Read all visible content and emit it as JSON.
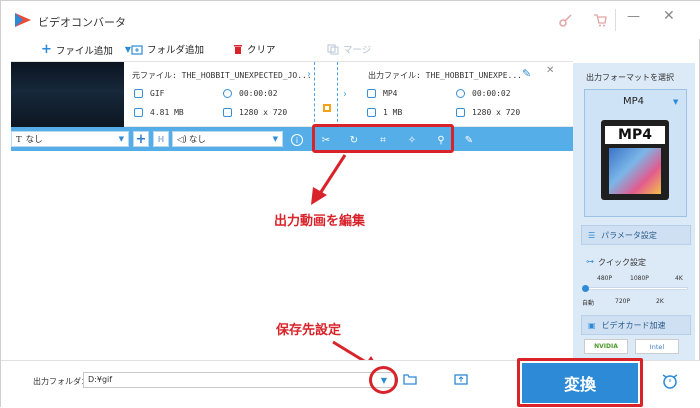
{
  "window": {
    "title": "ビデオコンバータ"
  },
  "toolbar": {
    "add_file": "ファイル追加",
    "add_folder": "フォルダ追加",
    "clear": "クリア",
    "merge": "マージ"
  },
  "file_row": {
    "source_label": "元ファイル: THE_HOBBIT_UNEXPECTED_JO...",
    "source_format": "GIF",
    "source_duration": "00:00:02",
    "source_size": "4.81 MB",
    "source_resolution": "1280 x 720",
    "output_label": "出力ファイル: THE_HOBBIT_UNEXPE...",
    "output_format": "MP4",
    "output_duration": "00:00:02",
    "output_size": "1 MB",
    "output_resolution": "1280 x 720"
  },
  "edit_bar": {
    "subtitle_select": "なし",
    "audio_select": "なし"
  },
  "annotations": {
    "edit_output": "出力動画を編集",
    "save_dest": "保存先設定"
  },
  "right_panel": {
    "select_format": "出力フォーマットを選択",
    "format_name": "MP4",
    "format_icon_text": "MP4",
    "param_settings": "パラメータ設定",
    "quick_settings": "クイック設定",
    "quality_top": [
      "480P",
      "1080P",
      "4K"
    ],
    "quality_bottom": [
      "自動",
      "720P",
      "2K"
    ],
    "gpu_accel": "ビデオカード加速",
    "nvidia": "NVIDIA",
    "intel": "Intel"
  },
  "bottom": {
    "output_folder_label": "出力フォルダ：",
    "output_folder_value": "D:¥gif",
    "convert_button": "変換"
  },
  "colors": {
    "accent": "#2d8ad6",
    "bar": "#56aee9",
    "annotation": "#d9232b"
  }
}
